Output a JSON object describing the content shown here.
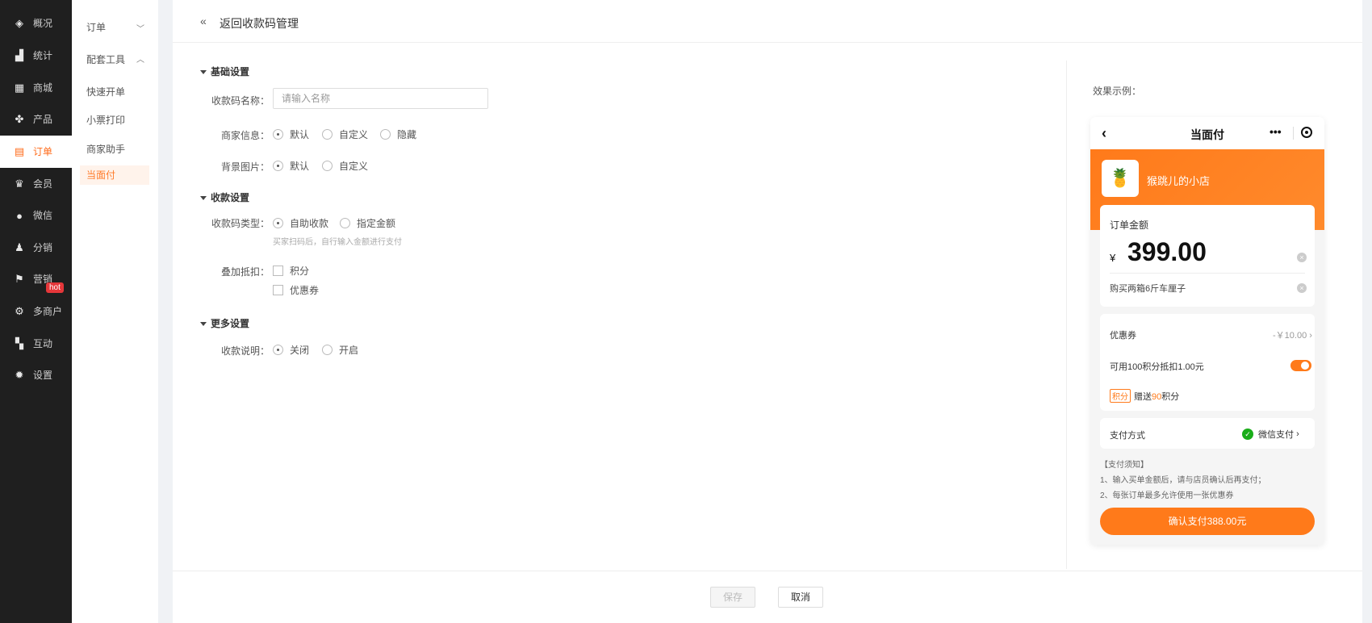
{
  "sidebar": {
    "items": [
      {
        "label": "概况",
        "icon": "layers-icon"
      },
      {
        "label": "统计",
        "icon": "chart-icon"
      },
      {
        "label": "商城",
        "icon": "shop-icon"
      },
      {
        "label": "产品",
        "icon": "grid-icon"
      },
      {
        "label": "订单",
        "icon": "clipboard-icon",
        "active": true
      },
      {
        "label": "会员",
        "icon": "crown-icon"
      },
      {
        "label": "微信",
        "icon": "wechat-icon"
      },
      {
        "label": "分销",
        "icon": "user-share-icon"
      },
      {
        "label": "营销",
        "icon": "flag-icon"
      },
      {
        "label": "多商户",
        "icon": "merchant-icon"
      },
      {
        "label": "互动",
        "icon": "apps-icon"
      },
      {
        "label": "设置",
        "icon": "gear-icon"
      }
    ],
    "hot_badge": "hot"
  },
  "subnav": {
    "group1": "订单",
    "group2": "配套工具",
    "items": [
      "快速开单",
      "小票打印",
      "商家助手",
      "当面付"
    ]
  },
  "topbar": {
    "back_label": "返回收款码管理"
  },
  "form": {
    "section_basic": "基础设置",
    "name_label": "收款码名称：",
    "name_placeholder": "请输入名称",
    "merchant_label": "商家信息：",
    "merchant_options": [
      "默认",
      "自定义",
      "隐藏"
    ],
    "bg_label": "背景图片：",
    "bg_options": [
      "默认",
      "自定义"
    ],
    "section_pay": "收款设置",
    "type_label": "收款码类型：",
    "type_options": [
      "自助收款",
      "指定金额"
    ],
    "type_hint": "买家扫码后，自行输入金额进行支付",
    "discount_label": "叠加抵扣：",
    "discount_options": [
      "积分",
      "优惠券"
    ],
    "section_more": "更多设置",
    "desc_label": "收款说明：",
    "desc_options": [
      "关闭",
      "开启"
    ]
  },
  "preview": {
    "label": "效果示例：",
    "title": "当面付",
    "shop_name": "猴跳儿的小店",
    "amount_title": "订单金额",
    "currency": "¥",
    "amount": "399.00",
    "note": "购买两箱6斤车厘子",
    "coupon_label": "优惠券",
    "coupon_value": "-￥10.00",
    "points_text": "可用100积分抵扣1.00元",
    "points_badge": "积分",
    "gift_prefix": "赠送",
    "gift_value": "90",
    "gift_suffix": "积分",
    "pay_method_label": "支付方式",
    "pay_method_value": "微信支付",
    "tips_title": "【支付须知】",
    "tip1": "1、输入买单金额后，请与店员确认后再支付；",
    "tip2": "2、每张订单最多允许使用一张优惠券",
    "pay_button": "确认支付388.00元"
  },
  "footer": {
    "save": "保存",
    "cancel": "取消"
  },
  "colors": {
    "accent": "#ff7a1a",
    "sidebar_bg": "#1f1f1f"
  }
}
